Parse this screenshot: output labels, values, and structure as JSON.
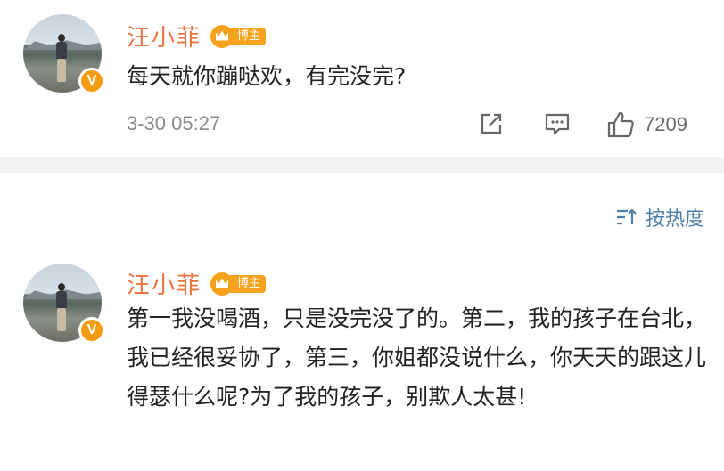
{
  "comments": [
    {
      "username": "汪小菲",
      "badge_label": "博主",
      "verified_mark": "V",
      "text": "每天就你蹦哒欢，有完没完?",
      "timestamp": "3-30 05:27",
      "likes": "7209"
    },
    {
      "username": "汪小菲",
      "badge_label": "博主",
      "verified_mark": "V",
      "text": "第一我没喝酒，只是没完没了的。第二，我的孩子在台北，我已经很妥协了，第三，你姐都没说什么，你天天的跟这儿得瑟什么呢?为了我的孩子，别欺人太甚!"
    }
  ],
  "sort": {
    "label": "按热度",
    "icon": "sort-icon"
  },
  "icons": {
    "share": "share-edit-icon",
    "comment": "comment-icon",
    "like": "thumbs-up-icon"
  },
  "colors": {
    "username": "#eb7340",
    "badge": "#f7a21c",
    "sort": "#4f7ea8",
    "meta": "#8c8c8c"
  }
}
